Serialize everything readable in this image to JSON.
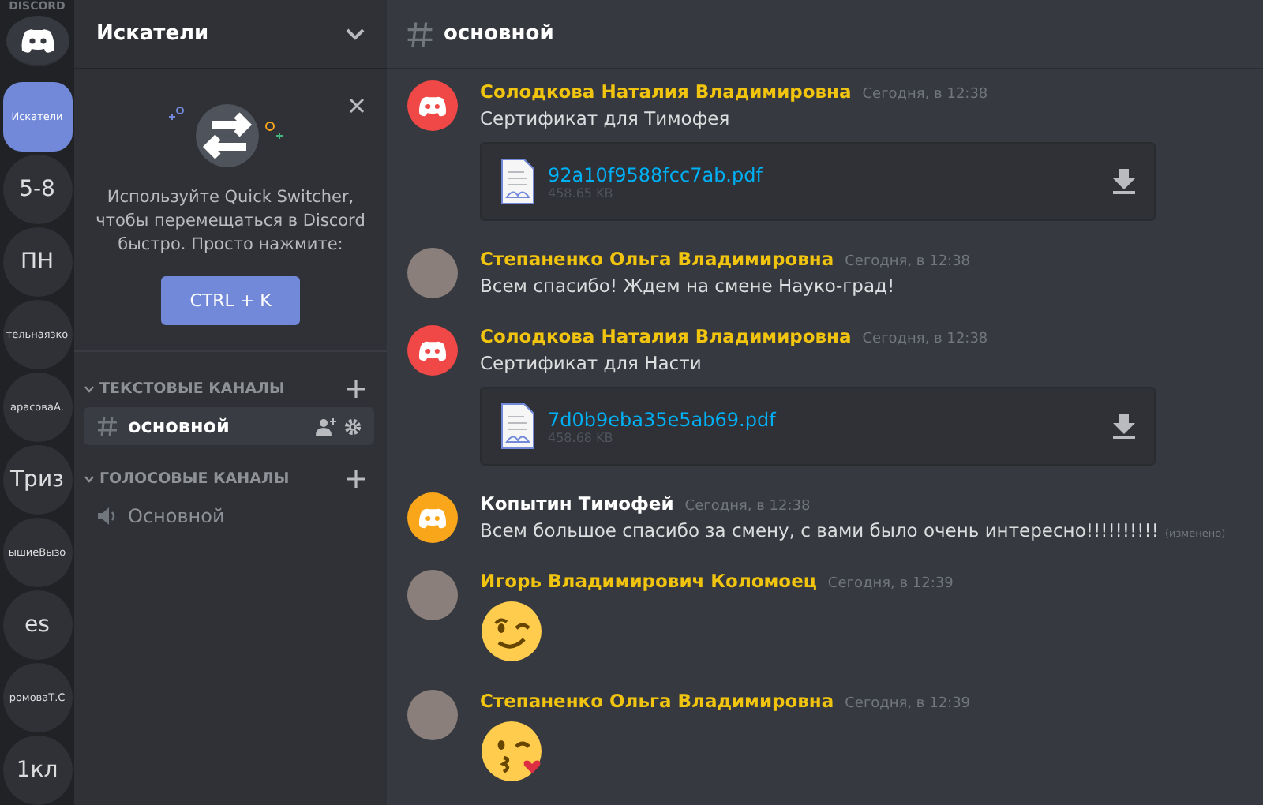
{
  "rail": {
    "wordmark": "DISCORD",
    "servers": [
      {
        "label": "Искатели",
        "selected": true
      },
      {
        "label": "5-8",
        "selected": false
      },
      {
        "label": "ПН",
        "selected": false
      },
      {
        "label": "тельнаязко",
        "selected": false
      },
      {
        "label": "арасоваА.",
        "selected": false
      },
      {
        "label": "Триз",
        "selected": false
      },
      {
        "label": "ышиеВызо",
        "selected": false
      },
      {
        "label": "es",
        "selected": false
      },
      {
        "label": "ромоваТ.С",
        "selected": false
      },
      {
        "label": "1кл",
        "selected": false
      }
    ]
  },
  "sidebar": {
    "server_name": "Искатели",
    "promo": {
      "text": "Используйте Quick Switcher, чтобы перемещаться в Discord быстро. Просто нажмите:",
      "button": "CTRL + K"
    },
    "categories": [
      {
        "title": "ТЕКСТОВЫЕ КАНАЛЫ",
        "kind": "text",
        "channels": [
          {
            "name": "основной",
            "selected": true
          }
        ]
      },
      {
        "title": "ГОЛОСОВЫЕ КАНАЛЫ",
        "kind": "voice",
        "channels": [
          {
            "name": "Основной",
            "selected": false
          }
        ]
      }
    ]
  },
  "chat": {
    "channel": "основной",
    "messages": [
      {
        "author": "Солодкова Наталия Владимировна",
        "color": "#f1c40f",
        "avatar": {
          "kind": "logo",
          "color": "#f04747"
        },
        "time": "Сегодня, в 12:38",
        "kind": "attachment",
        "text": "Сертификат для Тимофея",
        "file": "92a10f9588fcc7ab.pdf",
        "size": "458.65 KB"
      },
      {
        "author": "Степаненко Ольга Владимировна",
        "color": "#f1c40f",
        "avatar": {
          "kind": "photo"
        },
        "time": "Сегодня, в 12:38",
        "kind": "text",
        "text": "Всем спасибо! Ждем на смене Науко-град!"
      },
      {
        "author": "Солодкова Наталия Владимировна",
        "color": "#f1c40f",
        "avatar": {
          "kind": "logo",
          "color": "#f04747"
        },
        "time": "Сегодня, в 12:38",
        "kind": "attachment",
        "text": "Сертификат для Насти",
        "file": "7d0b9eba35e5ab69.pdf",
        "size": "458.68 KB"
      },
      {
        "author": "Копытин Тимофей",
        "color": "#ffffff",
        "avatar": {
          "kind": "logo",
          "color": "#faa61a"
        },
        "time": "Сегодня, в 12:38",
        "kind": "text",
        "text": "Всем большое спасибо за смену, с вами было очень интересно!!!!!!!!!!",
        "edited": "(изменено)"
      },
      {
        "author": "Игорь Владимирович Коломоец",
        "color": "#f1c40f",
        "avatar": {
          "kind": "photo"
        },
        "time": "Сегодня, в 12:39",
        "kind": "wink-emoji"
      },
      {
        "author": "Степаненко Ольга Владимировна",
        "color": "#f1c40f",
        "avatar": {
          "kind": "photo"
        },
        "time": "Сегодня, в 12:39",
        "kind": "kiss-emoji"
      }
    ]
  }
}
